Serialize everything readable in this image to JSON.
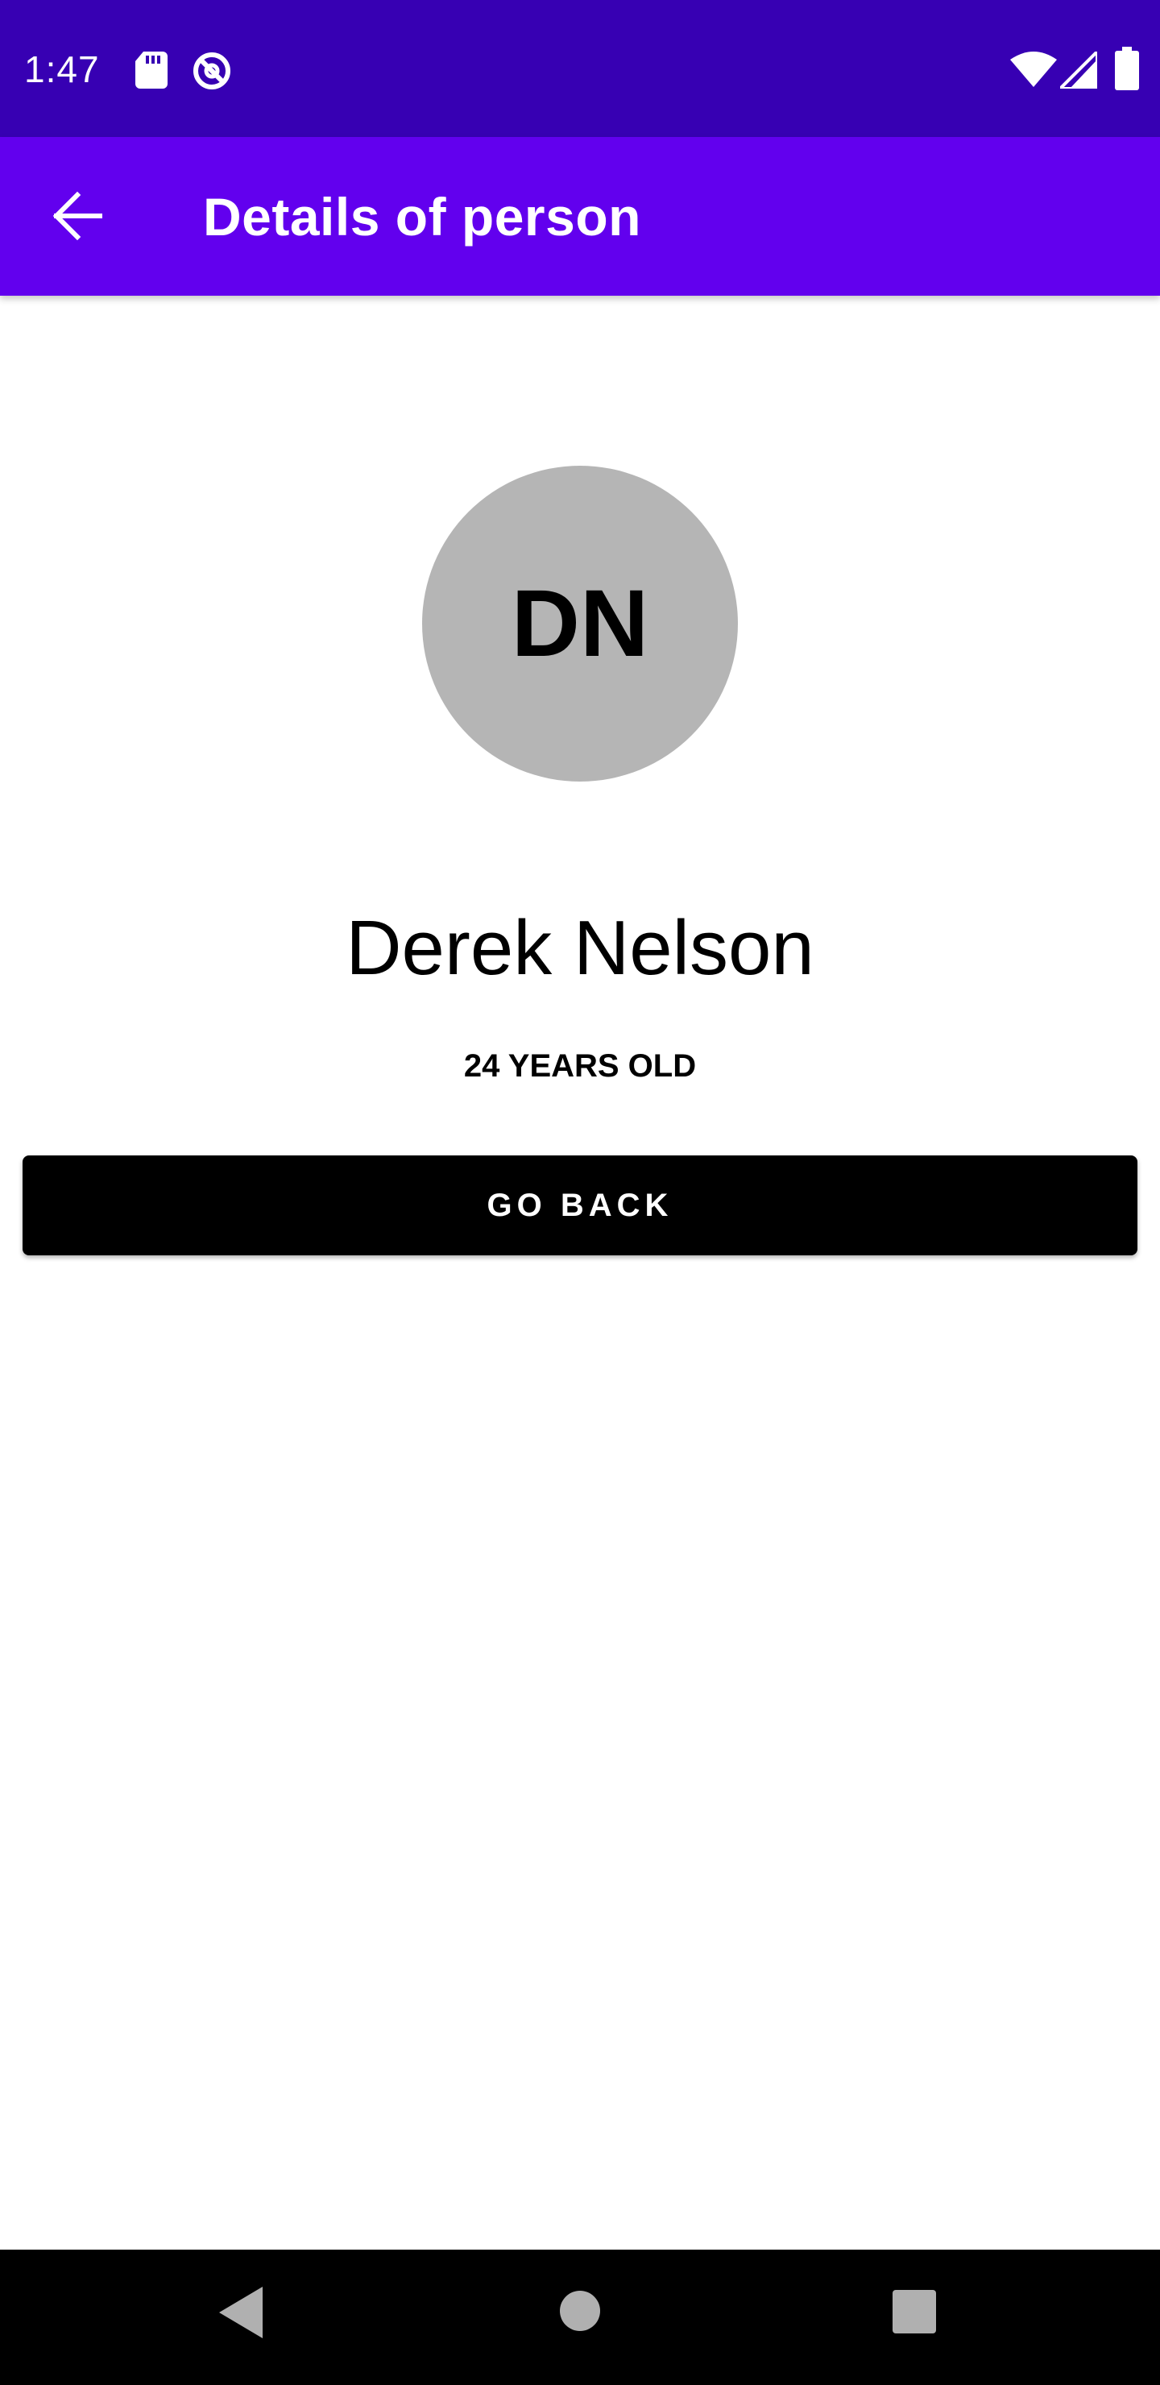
{
  "status_bar": {
    "time": "1:47",
    "icons": [
      "sd-card-icon",
      "data-saver-icon",
      "wifi-icon",
      "cell-signal-icon",
      "battery-icon"
    ]
  },
  "app_bar": {
    "title": "Details of person",
    "back_icon": "arrow-back-icon"
  },
  "person": {
    "initials": "DN",
    "name": "Derek Nelson",
    "age": "24 YEARS OLD"
  },
  "actions": {
    "go_back_label": "GO BACK"
  },
  "navigation": {
    "icons": [
      "nav-back-icon",
      "nav-home-icon",
      "nav-recents-icon"
    ]
  },
  "colors": {
    "status_bar": "#3700b3",
    "app_bar": "#6200ee",
    "avatar": "#b5b5b5",
    "button": "#000000",
    "nav_bar": "#000000"
  }
}
